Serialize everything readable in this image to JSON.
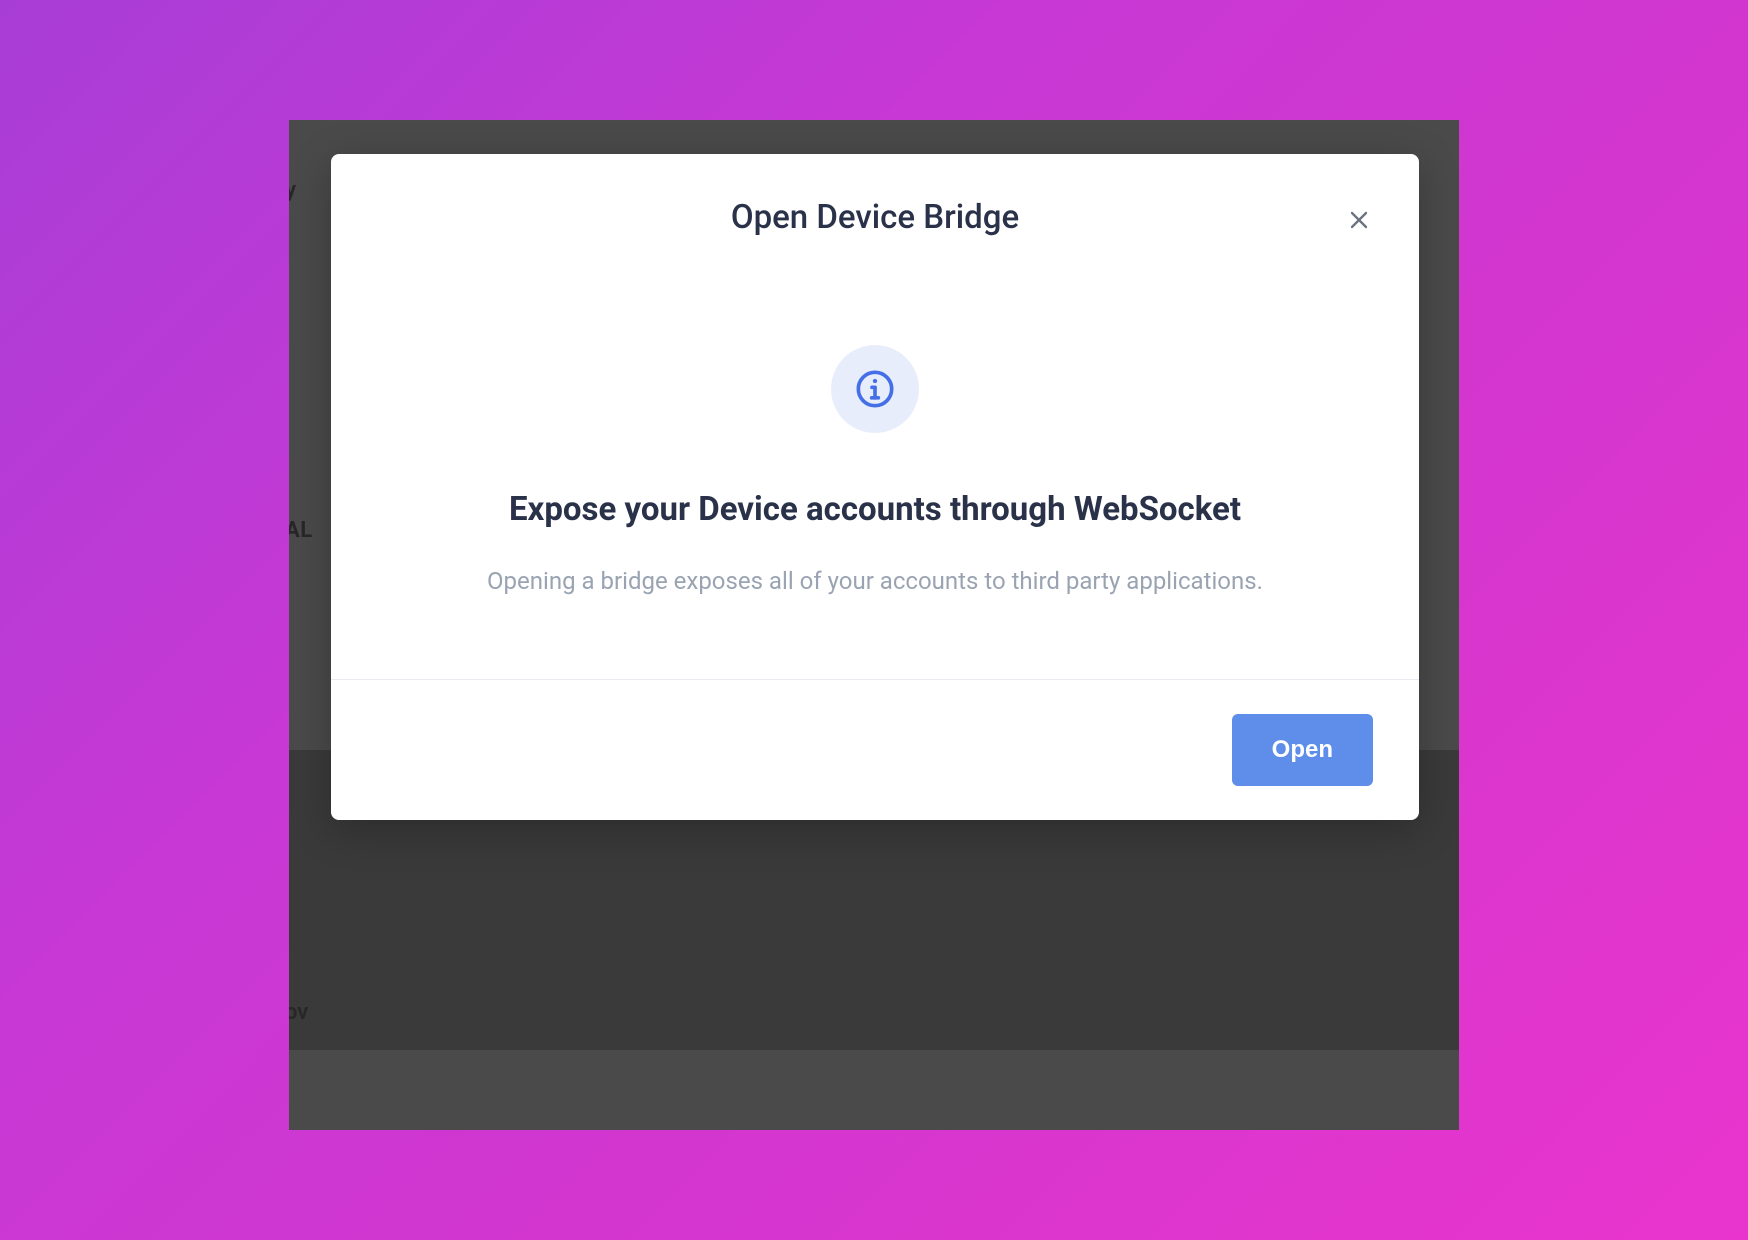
{
  "modal": {
    "title": "Open Device Bridge",
    "heading": "Expose your Device accounts through WebSocket",
    "description": "Opening a bridge exposes all of your accounts to third party applications.",
    "open_label": "Open"
  },
  "background": {
    "fragment_1": "ry",
    "fragment_2": "AL",
    "fragment_3": "ov"
  },
  "colors": {
    "accent_blue": "#5e8eea",
    "info_blue": "#456fe6",
    "info_bg": "#e7edfb",
    "heading": "#2a324a",
    "muted": "#9aa3b2"
  },
  "icons": {
    "close": "close-icon",
    "info": "info-icon"
  }
}
